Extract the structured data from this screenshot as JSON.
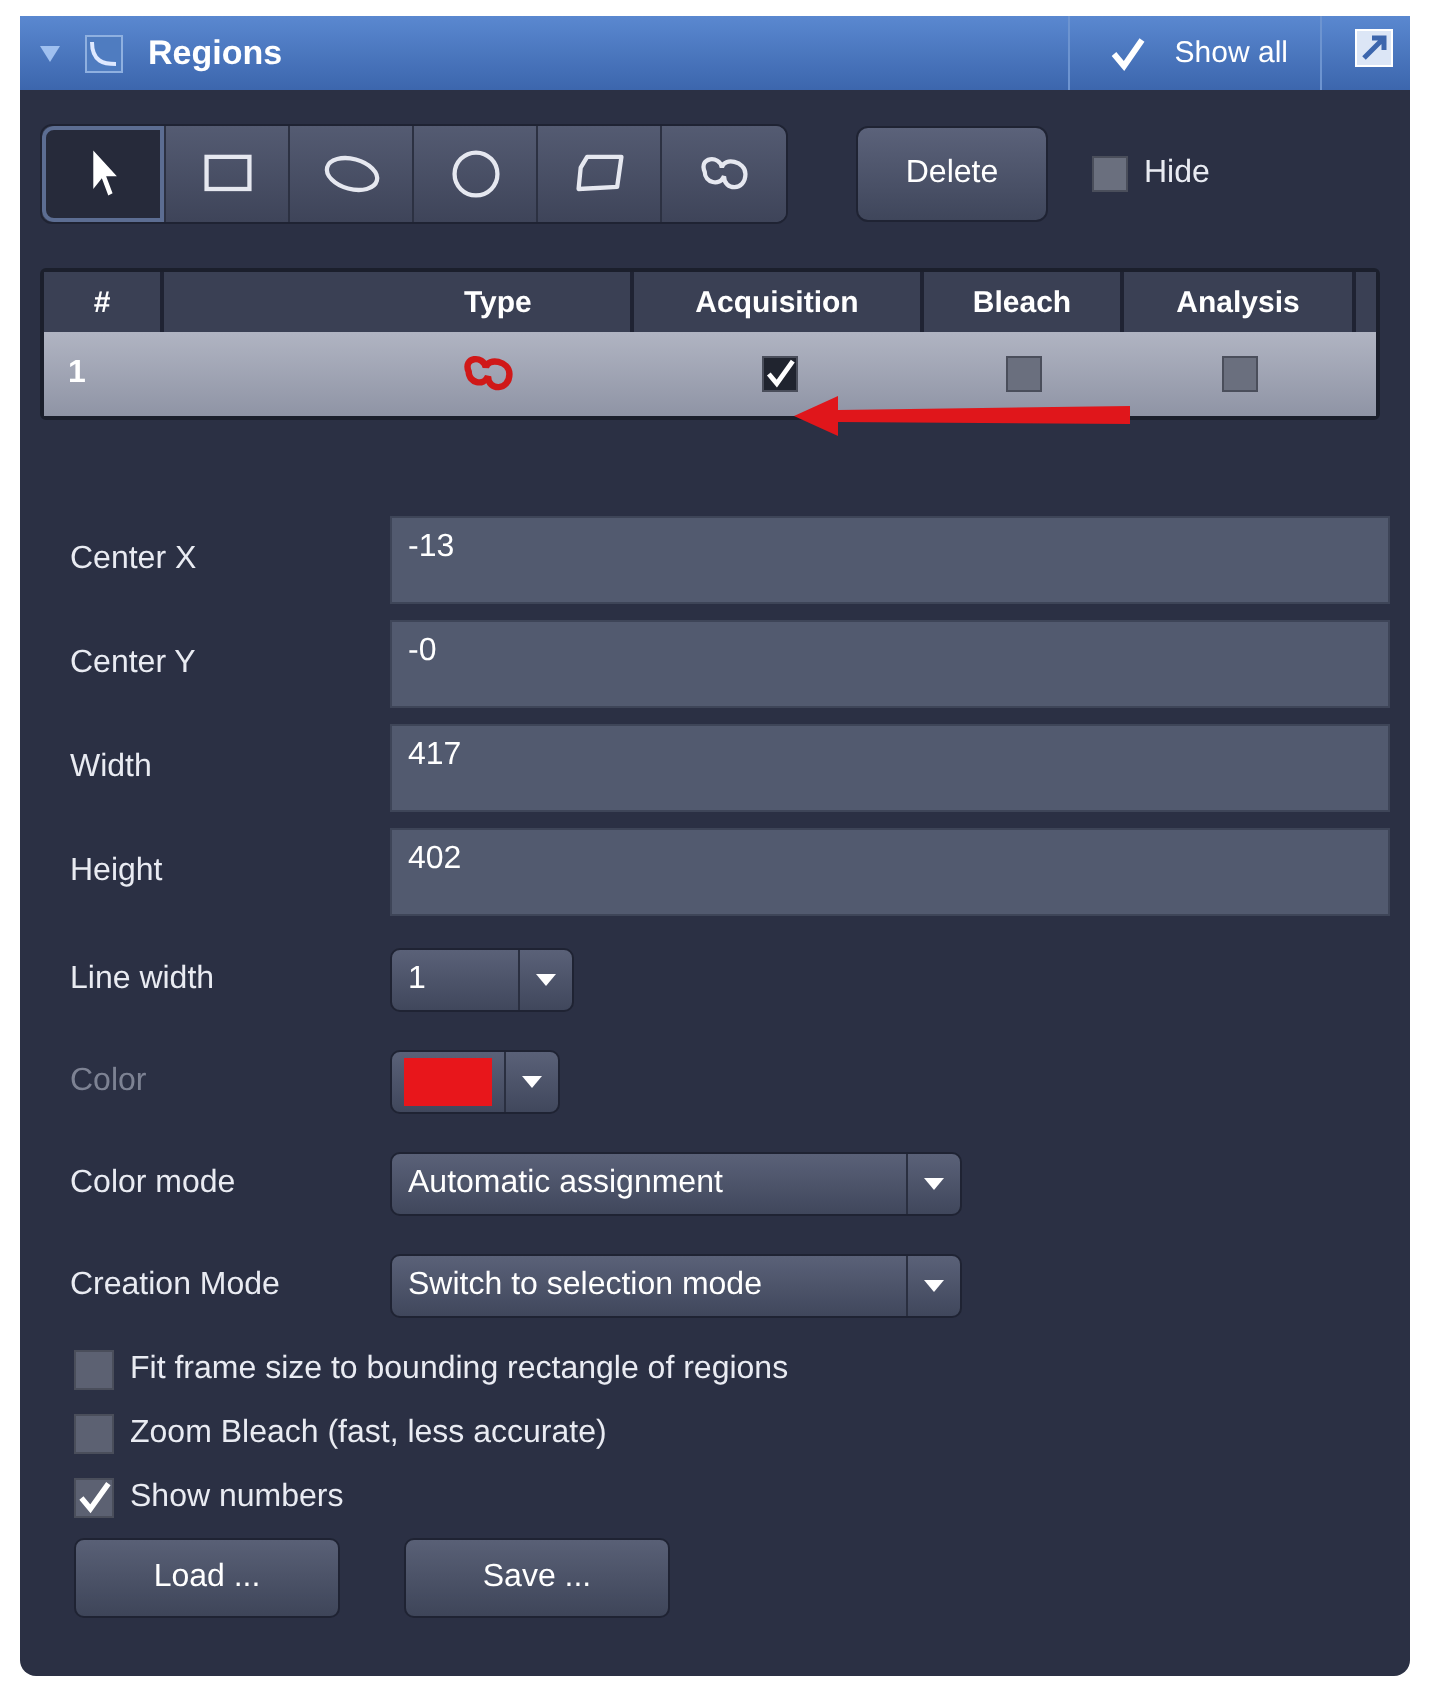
{
  "panel": {
    "title": "Regions",
    "expanded": true,
    "show_all": {
      "label": "Show all",
      "checked": true
    }
  },
  "tools": [
    {
      "kind": "pointer",
      "selected": true
    },
    {
      "kind": "rectangle",
      "selected": false
    },
    {
      "kind": "ellipse",
      "selected": false
    },
    {
      "kind": "circle",
      "selected": false
    },
    {
      "kind": "polygon",
      "selected": false
    },
    {
      "kind": "spline",
      "selected": false
    }
  ],
  "delete_button": "Delete",
  "hide": {
    "label": "Hide",
    "checked": false
  },
  "table": {
    "columns": [
      "#",
      "Type",
      "Acquisition",
      "Bleach",
      "Analysis"
    ],
    "rows": [
      {
        "number": "1",
        "kind": "spline",
        "acquisition": true,
        "bleach": false,
        "analysis": false,
        "selected": true
      }
    ]
  },
  "fields": [
    {
      "label": "Center X",
      "value": "-13"
    },
    {
      "label": "Center Y",
      "value": "-0"
    },
    {
      "label": "Width",
      "value": "417"
    },
    {
      "label": "Height",
      "value": "402"
    }
  ],
  "line_width": {
    "label": "Line width",
    "value": "1"
  },
  "color": {
    "label": "Color",
    "disabled": true,
    "color": "#e8161b"
  },
  "color_mode": {
    "label": "Color mode",
    "value": "Automatic assignment"
  },
  "creation_mode": {
    "label": "Creation Mode",
    "value": "Switch to selection mode"
  },
  "options": [
    {
      "label": "Fit frame size to bounding rectangle of regions",
      "checked": false
    },
    {
      "label": "Zoom Bleach (fast, less accurate)",
      "checked": false
    },
    {
      "label": "Show numbers",
      "checked": true
    }
  ],
  "buttons": [
    "Load ...",
    "Save ..."
  ]
}
